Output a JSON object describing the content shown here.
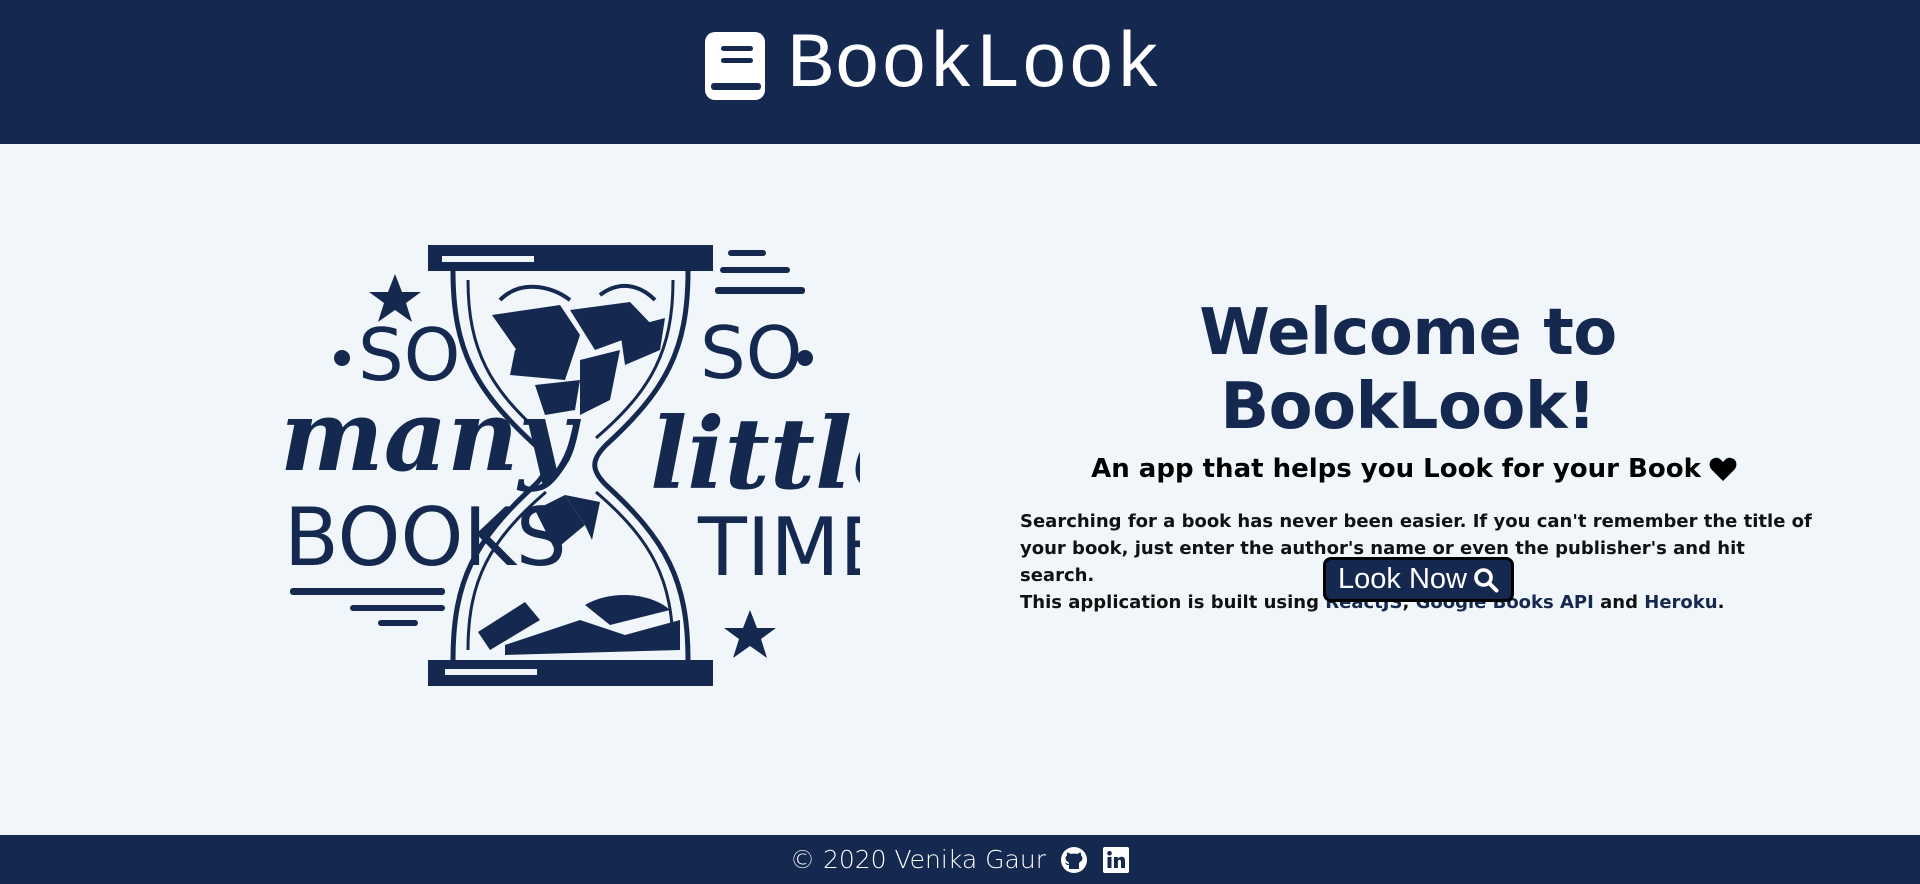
{
  "header": {
    "brand": "BookLook",
    "logo_icon": "book-icon",
    "background": "#152850"
  },
  "hero": {
    "illustration": {
      "icon": "hourglass-books-illustration",
      "left_text_top": "SO",
      "left_text_mid": "many",
      "left_text_bottom": "BOOKS",
      "right_text_top": "SO",
      "right_text_mid": "little",
      "right_text_bottom": "TIME"
    },
    "title": "Welcome to BookLook!",
    "tagline": "An app that helps you Look for your Book",
    "tagline_icon": "heart-icon",
    "description_line1": "Searching for a book has never been easier. If you can't remember the title of your book, just enter the author's name or even the publisher's and hit search.",
    "description_prefix": "This application is built using",
    "tech_reactjs": "ReactJS",
    "tech_google": "Google Books API",
    "tech_heroku": "Heroku",
    "sep_comma": ",",
    "sep_and": "and",
    "end_period": ".",
    "cta_label": "Look Now",
    "cta_icon": "search-icon"
  },
  "footer": {
    "copyright": "© 2020 Venika Gaur",
    "github_icon": "github-icon",
    "linkedin_icon": "linkedin-icon"
  },
  "colors": {
    "navy": "#152850",
    "page_bg": "#f0f6f9",
    "white": "#ffffff"
  }
}
